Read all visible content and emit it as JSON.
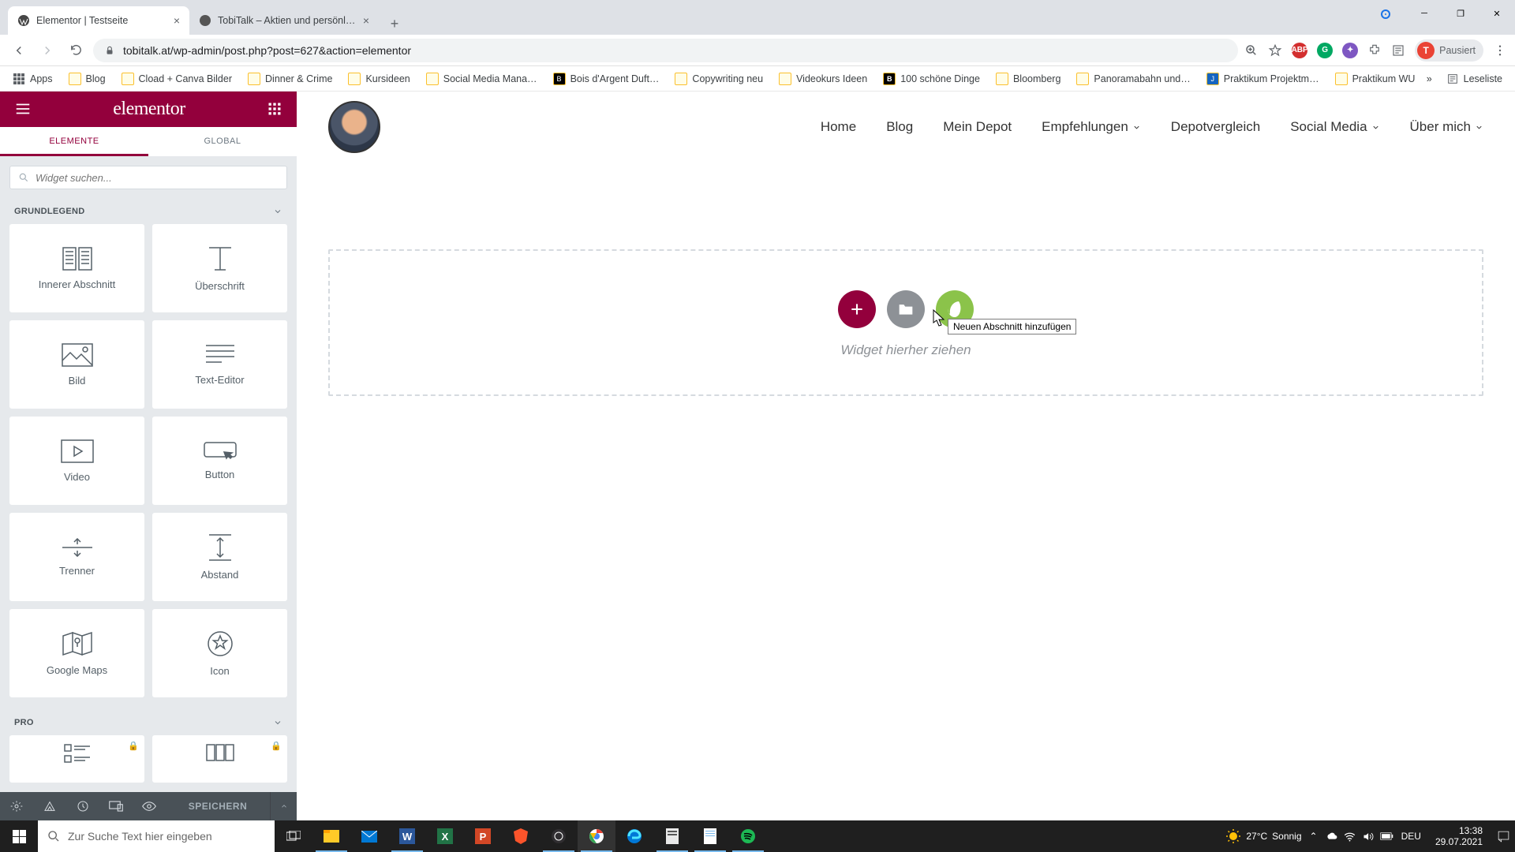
{
  "browser": {
    "tabs": [
      {
        "title": "Elementor | Testseite",
        "active": true
      },
      {
        "title": "TobiTalk – Aktien und persönliche…",
        "active": false
      }
    ],
    "url": "tobitalk.at/wp-admin/post.php?post=627&action=elementor",
    "profile_label": "Pausiert",
    "profile_initial": "T",
    "bookmarks": [
      "Blog",
      "Cload + Canva Bilder",
      "Dinner & Crime",
      "Kursideen",
      "Social Media Mana…",
      "Bois d'Argent Duft…",
      "Copywriting neu",
      "Videokurs Ideen",
      "100 schöne Dinge",
      "Bloomberg",
      "Panoramabahn und…",
      "Praktikum Projektm…",
      "Praktikum WU"
    ],
    "apps_label": "Apps",
    "readlist_label": "Leseliste"
  },
  "elementor": {
    "logo": "elementor",
    "tabs": {
      "elements": "ELEMENTE",
      "global": "GLOBAL"
    },
    "search_placeholder": "Widget suchen...",
    "categories": {
      "basic": "GRUNDLEGEND",
      "pro": "PRO"
    },
    "widgets": [
      "Innerer Abschnitt",
      "Überschrift",
      "Bild",
      "Text-Editor",
      "Video",
      "Button",
      "Trenner",
      "Abstand",
      "Google Maps",
      "Icon"
    ],
    "save_label": "SPEICHERN"
  },
  "site_nav": [
    "Home",
    "Blog",
    "Mein Depot",
    "Empfehlungen",
    "Depotvergleich",
    "Social Media",
    "Über mich"
  ],
  "dropzone": {
    "tooltip": "Neuen Abschnitt hinzufügen",
    "hint": "Widget hierher ziehen"
  },
  "taskbar": {
    "search_placeholder": "Zur Suche Text hier eingeben",
    "weather_temp": "27°C",
    "weather_text": "Sonnig",
    "lang": "DEU",
    "time": "13:38",
    "date": "29.07.2021"
  }
}
